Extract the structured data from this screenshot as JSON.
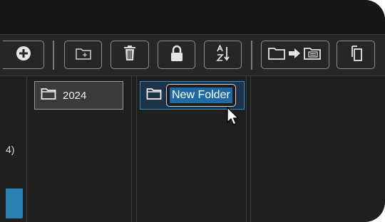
{
  "toolbar": {
    "buttons": [
      {
        "name": "add-button",
        "icon": "plus-circle-icon"
      },
      {
        "name": "new-folder-button",
        "icon": "new-folder-icon"
      },
      {
        "name": "delete-button",
        "icon": "trash-icon"
      },
      {
        "name": "lock-button",
        "icon": "lock-icon"
      },
      {
        "name": "sort-button",
        "icon": "sort-az-icon"
      },
      {
        "name": "move-to-button",
        "icon": "move-folder-icon"
      },
      {
        "name": "copy-button",
        "icon": "copy-icon"
      }
    ]
  },
  "left_pane": {
    "partial_text": "4)"
  },
  "pane_2": {
    "items": [
      {
        "label": "2024",
        "icon": "folder-icon"
      }
    ]
  },
  "pane_3": {
    "items": [
      {
        "label": "New Folder",
        "icon": "folder-icon",
        "state": "renaming",
        "selected_text": "New Folder"
      }
    ]
  },
  "colors": {
    "background": "#1f1f1f",
    "toolbar": "#262626",
    "selection_blue": "#2f8cc4",
    "text_highlight": "#1f6aa5"
  }
}
